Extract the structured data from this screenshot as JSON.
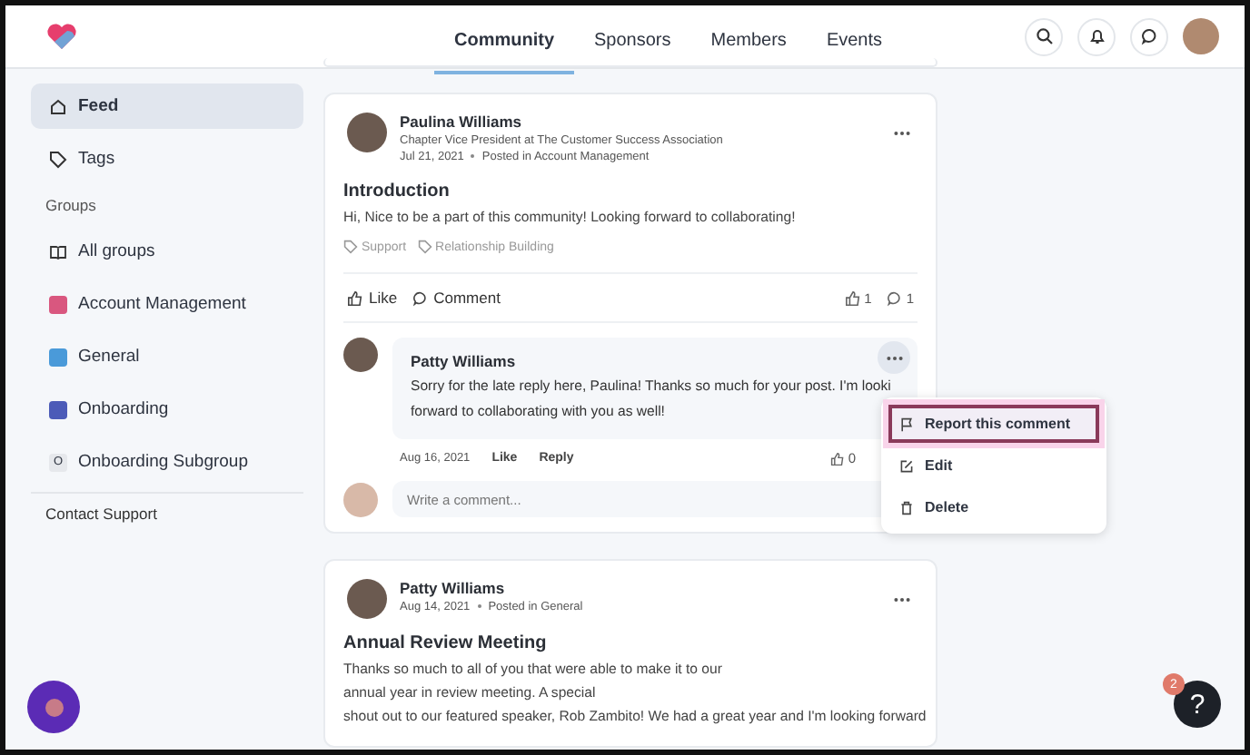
{
  "nav": {
    "tabs": [
      {
        "label": "Community",
        "selected": true
      },
      {
        "label": "Sponsors",
        "selected": false
      },
      {
        "label": "Members",
        "selected": false
      },
      {
        "label": "Events",
        "selected": false
      }
    ]
  },
  "sidebar": {
    "items": [
      {
        "label": "Feed",
        "kind": "home",
        "selected": true
      },
      {
        "label": "Tags",
        "kind": "tag",
        "selected": false
      }
    ],
    "groups_heading": "Groups",
    "groups": [
      {
        "label": "All groups",
        "kind": "book",
        "selected": false
      },
      {
        "label": "Account Management",
        "kind": "image",
        "color": "#d9577f",
        "selected": false
      },
      {
        "label": "General",
        "kind": "image",
        "color": "#4a9ad9",
        "selected": false
      },
      {
        "label": "Onboarding",
        "kind": "image",
        "color": "#4c5bb8",
        "selected": false
      },
      {
        "label": "Onboarding Subgroup",
        "kind": "letter",
        "letter": "O",
        "selected": false
      }
    ],
    "contact": "Contact Support"
  },
  "posts": [
    {
      "author": "Paulina Williams",
      "role": "Chapter Vice President at The Customer Success Association",
      "date": "Jul 21, 2021",
      "posted_in": "Posted in Account Management",
      "title": "Introduction",
      "body": [
        "Hi, Nice to be a part of this community! Looking forward to collaborating!"
      ],
      "tags": [
        "Support",
        "Relationship Building"
      ],
      "like_label": "Like",
      "comment_label": "Comment",
      "like_count": "1",
      "comment_count": "1",
      "comment": {
        "author": "Patty Williams",
        "lines": [
          "Sorry for the late reply here, Paulina!  Thanks so much for your post.  I'm looki",
          "forward to collaborating with you as well!"
        ],
        "date": "Aug 16, 2021",
        "like": "Like",
        "reply": "Reply",
        "like_count": "0"
      },
      "composer": {
        "placeholder": "Write a comment..."
      }
    },
    {
      "author": "Patty Williams",
      "date": "Aug 14, 2021",
      "posted_in": "Posted in General",
      "title": "Annual Review Meeting",
      "body": [
        "Thanks so much to all of you that were able to make it to our",
        "annual year in review meeting. A special",
        "shout out to our featured speaker, Rob Zambito! We had a great year and I'm looking forward"
      ]
    }
  ],
  "menu": {
    "items": [
      {
        "label": "Report this comment",
        "kind": "flag",
        "highlighted": true
      },
      {
        "label": "Edit",
        "kind": "edit",
        "highlighted": false
      },
      {
        "label": "Delete",
        "kind": "trash",
        "highlighted": false
      }
    ]
  },
  "help": {
    "badge": "2",
    "label": "?"
  }
}
